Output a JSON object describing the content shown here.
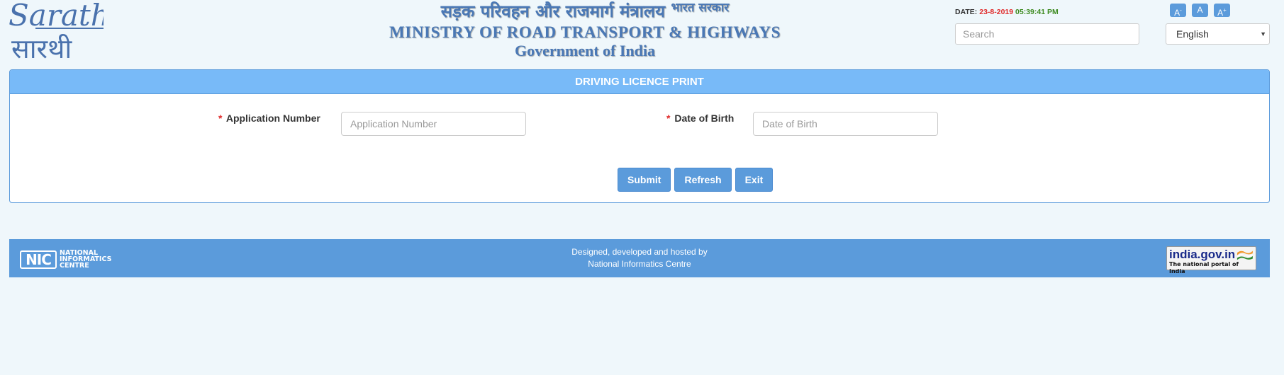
{
  "header": {
    "logo": {
      "latin": "Sarathi",
      "devanagari": "सारथी"
    },
    "ministry": {
      "hindi": "सड़क परिवहन और राजमार्ग मंत्रालय",
      "hindi_sup": "भारत सरकार",
      "english": "MINISTRY OF ROAD TRANSPORT & HIGHWAYS",
      "government": "Government of India"
    },
    "date_label": "DATE:",
    "date_value": "23-8-2019",
    "time_value": "05:39:41 PM",
    "search_placeholder": "Search",
    "font_size_buttons": [
      {
        "label": "A",
        "sup": "-",
        "icon": "font-decrease-icon"
      },
      {
        "label": "A",
        "sup": "",
        "icon": "font-reset-icon"
      },
      {
        "label": "A",
        "sup": "+",
        "icon": "font-increase-icon"
      }
    ],
    "language": {
      "selected": "English",
      "icon": "caret-down-icon"
    }
  },
  "panel": {
    "title": "DRIVING LICENCE PRINT",
    "required_marker": "*",
    "fields": [
      {
        "label": "Application Number",
        "placeholder": "Application Number",
        "value": ""
      },
      {
        "label": "Date of Birth",
        "placeholder": "Date of Birth",
        "value": ""
      }
    ],
    "buttons": {
      "submit": "Submit",
      "refresh": "Refresh",
      "exit": "Exit"
    }
  },
  "footer": {
    "nic_logo": {
      "mark": "NIC",
      "lines": [
        "NATIONAL",
        "INFORMATICS",
        "CENTRE"
      ]
    },
    "credit_line1": "Designed, developed and hosted by",
    "credit_line2": "National Informatics Centre",
    "india_portal": {
      "title": "india.gov.in",
      "subtitle": "The national portal of India"
    }
  },
  "colors": {
    "page_background": "#eff7fb",
    "panel_header": "#78baf8",
    "primary_button": "#5b9bdb",
    "footer": "#5b9bdb",
    "ministry_text": "#4a78b5",
    "date_red": "#e02b2b",
    "time_green": "#3d8a1f"
  }
}
